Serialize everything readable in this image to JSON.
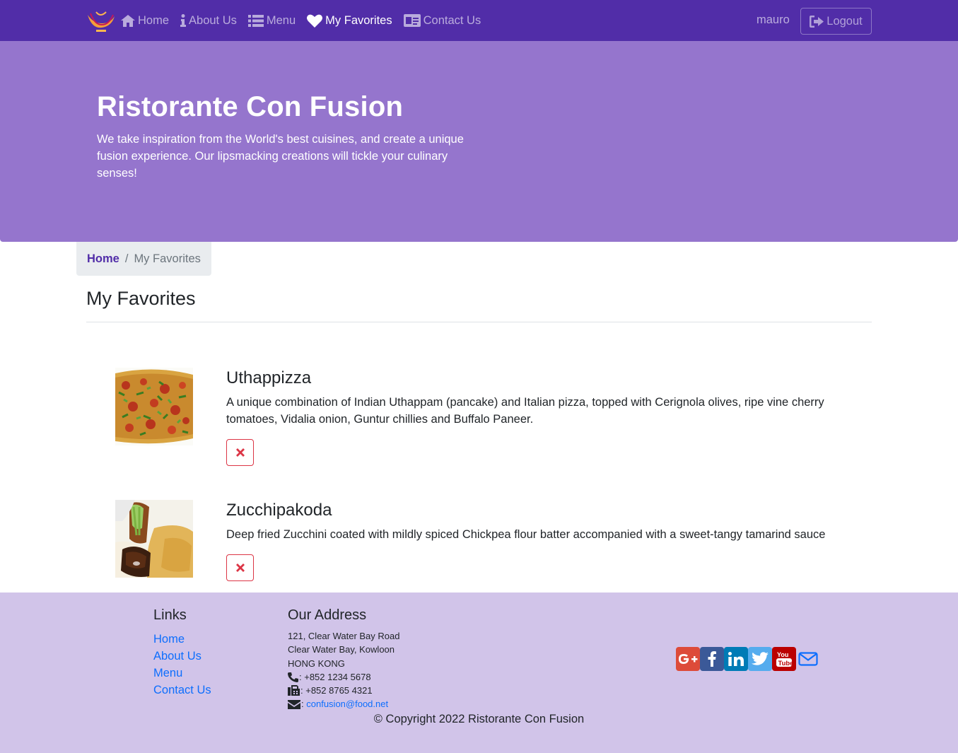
{
  "nav": {
    "items": [
      {
        "label": "Home",
        "icon": "home-icon"
      },
      {
        "label": "About Us",
        "icon": "info-icon"
      },
      {
        "label": "Menu",
        "icon": "list-icon"
      },
      {
        "label": "My Favorites",
        "icon": "heart-icon",
        "active": true
      },
      {
        "label": "Contact Us",
        "icon": "address-card-icon"
      }
    ],
    "username": "mauro",
    "logout_label": "Logout"
  },
  "jumbotron": {
    "title": "Ristorante Con Fusion",
    "text": "We take inspiration from the World's best cuisines, and create a unique fusion experience. Our lipsmacking creations will tickle your culinary senses!"
  },
  "breadcrumb": {
    "home": "Home",
    "current": "My Favorites"
  },
  "page_title": "My Favorites",
  "favorites": [
    {
      "name": "Uthappizza",
      "description": "A unique combination of Indian Uthappam (pancake) and Italian pizza, topped with Cerignola olives, ripe vine cherry tomatoes, Vidalia onion, Guntur chillies and Buffalo Paneer."
    },
    {
      "name": "Zucchipakoda",
      "description": "Deep fried Zucchini coated with mildly spiced Chickpea flour batter accompanied with a sweet-tangy tamarind sauce"
    }
  ],
  "footer": {
    "links_title": "Links",
    "links": [
      "Home",
      "About Us",
      "Menu",
      "Contact Us"
    ],
    "address_title": "Our Address",
    "address_lines": [
      "121, Clear Water Bay Road",
      "Clear Water Bay, Kowloon",
      "HONG KONG"
    ],
    "phone": ": +852 1234 5678",
    "fax": ": +852 8765 4321",
    "email_prefix": ":",
    "email": "confusion@food.net",
    "copyright": "© Copyright 2022 Ristorante Con Fusion"
  },
  "colors": {
    "primary": "#512DA8",
    "jumbotron": "#9575CD",
    "footer": "#D1C4E9",
    "danger": "#dc3545"
  }
}
